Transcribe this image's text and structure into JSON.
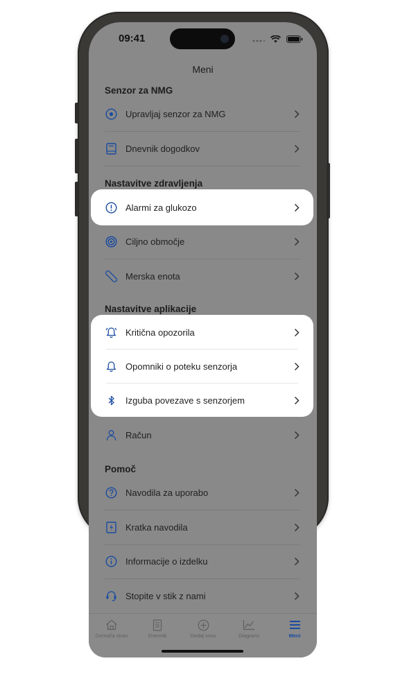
{
  "status_bar": {
    "time": "09:41"
  },
  "app": {
    "title": "Meni"
  },
  "colors": {
    "accent": "#1a4ba0",
    "overlay": "#898989",
    "card": "#ffffff"
  },
  "sections": [
    {
      "header": "Senzor za NMG",
      "items": [
        {
          "label": "Upravljaj senzor za NMG",
          "icon": "sensor-icon"
        },
        {
          "label": "Dnevnik dogodkov",
          "icon": "logbook-icon"
        }
      ]
    },
    {
      "header": "Nastavitve zdravljenja",
      "items": [
        {
          "label": "Alarmi za glukozo",
          "icon": "alert-circle-icon"
        },
        {
          "label": "Ciljno območje",
          "icon": "target-icon"
        },
        {
          "label": "Merska enota",
          "icon": "ruler-icon"
        }
      ]
    },
    {
      "header": "Nastavitve aplikacije",
      "items": [
        {
          "label": "Kritična opozorila",
          "icon": "bell-alert-icon"
        },
        {
          "label": "Opomniki o poteku senzorja",
          "icon": "bell-icon"
        },
        {
          "label": "Izguba povezave s senzorjem",
          "icon": "bluetooth-icon"
        },
        {
          "label": "Račun",
          "icon": "person-icon"
        }
      ]
    },
    {
      "header": "Pomoč",
      "items": [
        {
          "label": "Navodila za uporabo",
          "icon": "help-icon"
        },
        {
          "label": "Kratka navodila",
          "icon": "quick-guide-icon"
        },
        {
          "label": "Informacije o izdelku",
          "icon": "info-icon"
        },
        {
          "label": "Stopite v stik z nami",
          "icon": "headset-icon"
        }
      ]
    }
  ],
  "tabs": [
    {
      "label": "Domača stran",
      "icon": "home-icon",
      "active": false
    },
    {
      "label": "Dnevnik",
      "icon": "logbook-icon",
      "active": false
    },
    {
      "label": "Dodaj vnos",
      "icon": "add-circle-icon",
      "active": false
    },
    {
      "label": "Diagrami",
      "icon": "chart-icon",
      "active": false
    },
    {
      "label": "Meni",
      "icon": "menu-icon",
      "active": true
    }
  ]
}
